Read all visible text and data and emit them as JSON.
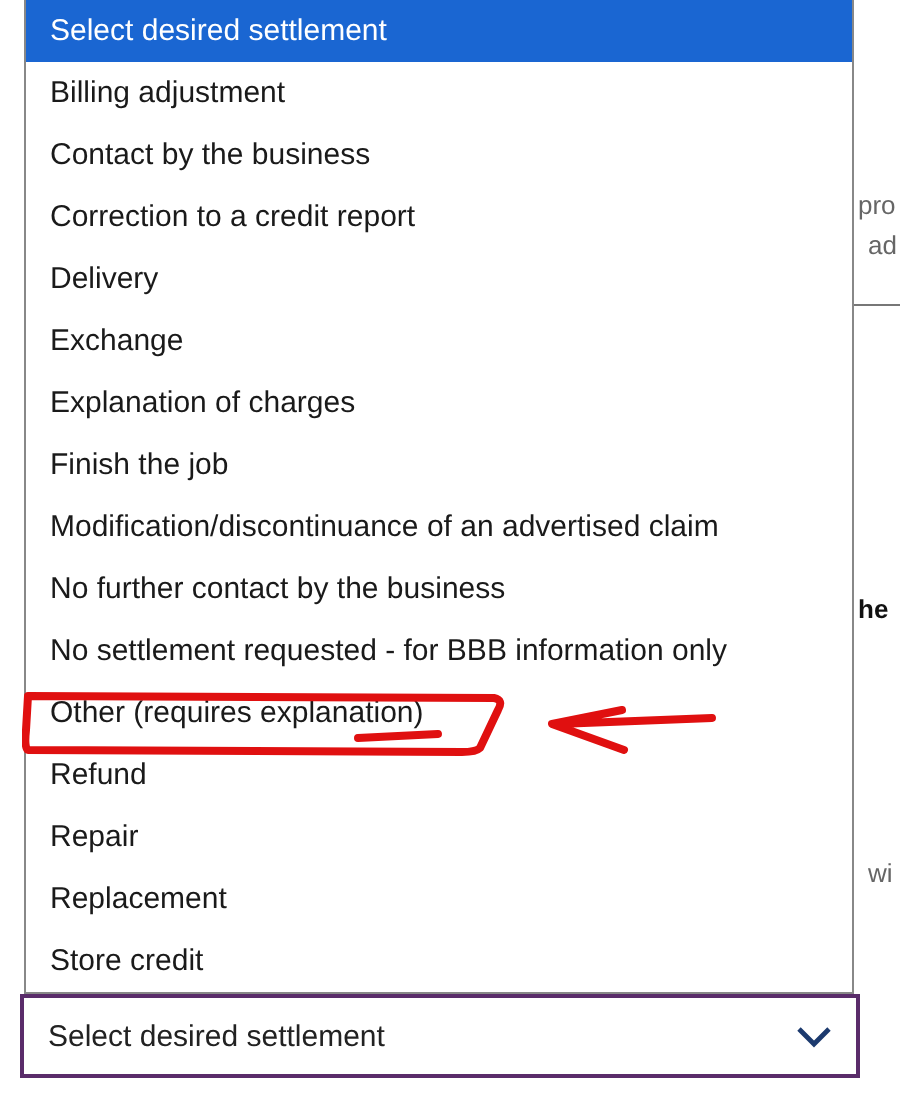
{
  "background_text": [
    "pro",
    "ad",
    "he",
    "wi"
  ],
  "dropdown": {
    "options": [
      {
        "label": "Select desired settlement",
        "selected": true
      },
      {
        "label": "Billing adjustment",
        "selected": false
      },
      {
        "label": "Contact by the business",
        "selected": false
      },
      {
        "label": "Correction to a credit report",
        "selected": false
      },
      {
        "label": "Delivery",
        "selected": false
      },
      {
        "label": "Exchange",
        "selected": false
      },
      {
        "label": "Explanation of charges",
        "selected": false
      },
      {
        "label": "Finish the job",
        "selected": false
      },
      {
        "label": "Modification/discontinuance of an advertised claim",
        "selected": false
      },
      {
        "label": "No further contact by the business",
        "selected": false
      },
      {
        "label": "No settlement requested - for BBB information only",
        "selected": false
      },
      {
        "label": "Other (requires explanation)",
        "selected": false
      },
      {
        "label": "Refund",
        "selected": false
      },
      {
        "label": "Repair",
        "selected": false
      },
      {
        "label": "Replacement",
        "selected": false
      },
      {
        "label": "Store credit",
        "selected": false
      }
    ],
    "value": "Select desired settlement"
  }
}
